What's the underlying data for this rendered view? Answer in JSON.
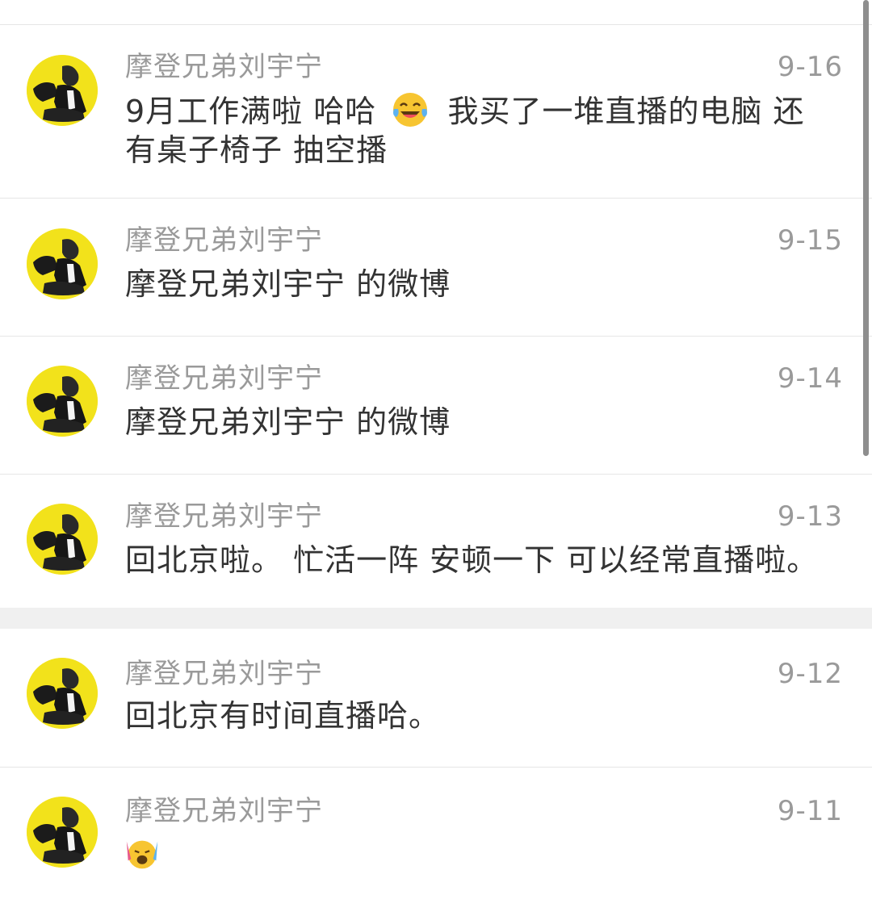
{
  "posts": [
    {
      "author": "摩登兄弟刘宇宁",
      "date": "9-16",
      "text_a": "9月工作满啦 哈哈",
      "emoji": "laugh-tears-emoji",
      "text_b": "我买了一堆直播的电脑 还有桌子椅子 抽空播"
    },
    {
      "author": "摩登兄弟刘宇宁",
      "date": "9-15",
      "text": "摩登兄弟刘宇宁 的微博"
    },
    {
      "author": "摩登兄弟刘宇宁",
      "date": "9-14",
      "text": "摩登兄弟刘宇宁 的微博"
    },
    {
      "author": "摩登兄弟刘宇宁",
      "date": "9-13",
      "text": "回北京啦。 忙活一阵 安顿一下 可以经常直播啦。"
    },
    {
      "author": "摩登兄弟刘宇宁",
      "date": "9-12",
      "text": "回北京有时间直播哈。"
    },
    {
      "author": "摩登兄弟刘宇宁",
      "date": "9-11",
      "emoji": "crying-excited-emoji"
    }
  ],
  "colors": {
    "avatar_bg": "#f2e21b",
    "meta_text": "#9a9a9a",
    "body_text": "#333333",
    "divider": "#e6e6e6",
    "section_gap": "#f0f0f0"
  }
}
